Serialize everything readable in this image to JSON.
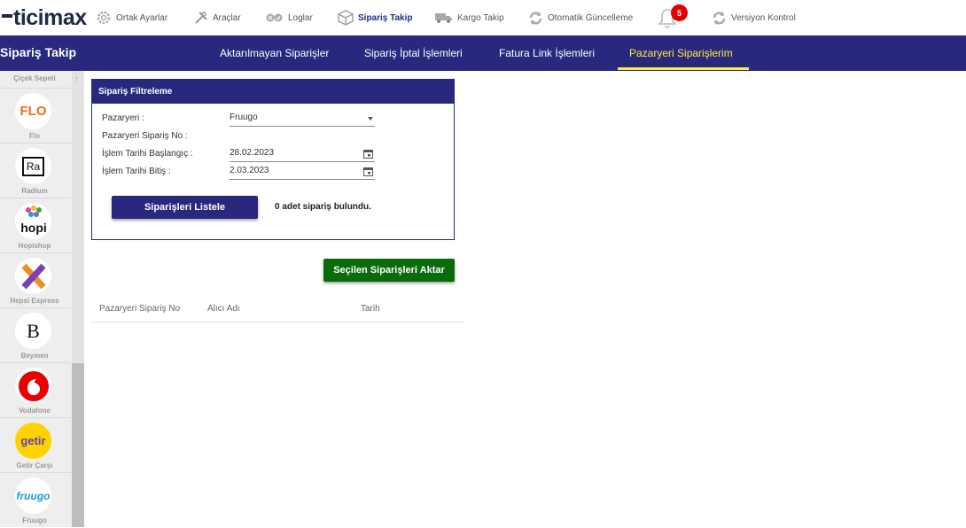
{
  "brand": {
    "logo_text": "ticimax"
  },
  "topnav": [
    {
      "label": "Ortak Ayarlar",
      "icon": "gear-icon"
    },
    {
      "label": "Araçlar",
      "icon": "tools-icon"
    },
    {
      "label": "Loglar",
      "icon": "logs-icon"
    },
    {
      "label": "Sipariş Takip",
      "icon": "box-icon",
      "active": true
    },
    {
      "label": "Kargo Takip",
      "icon": "truck-icon"
    },
    {
      "label": "Otomatik Güncelleme",
      "icon": "sync-icon"
    },
    {
      "label": "Versiyon Kontrol",
      "icon": "sync-icon"
    }
  ],
  "notifications": {
    "count": "5"
  },
  "header": {
    "page_title": "Sipariş Takip",
    "tabs": [
      {
        "label": "Aktarılmayan Siparişler"
      },
      {
        "label": "Sipariş İptal İşlemleri"
      },
      {
        "label": "Fatura Link İşlemleri"
      },
      {
        "label": "Pazaryeri Siparişlerim",
        "active": true
      }
    ]
  },
  "sidebar": {
    "first_label": "Çiçek Sepeti",
    "items": [
      {
        "label": "Flo",
        "logo": "FLO"
      },
      {
        "label": "Radium",
        "logo": "Ra"
      },
      {
        "label": "Hopishop",
        "logo": "hopi"
      },
      {
        "label": "Hepsi Express",
        "logo": "X"
      },
      {
        "label": "Beymen",
        "logo": "B"
      },
      {
        "label": "Vodafone",
        "logo": ""
      },
      {
        "label": "Getir Çarşı",
        "logo": "getir"
      },
      {
        "label": "Fruugo",
        "logo": "fruugo"
      }
    ]
  },
  "filter": {
    "title": "Sipariş Filtreleme",
    "marketplace_label": "Pazaryeri :",
    "marketplace_value": "Fruugo",
    "order_no_label": "Pazaryeri Sipariş No :",
    "order_no_value": "",
    "start_label": "İşlem Tarihi Başlangıç :",
    "start_value": "28.02.2023",
    "end_label": "İşlem Tarihi Bitiş :",
    "end_value": "2.03.2023",
    "list_button": "Siparişleri Listele",
    "result_text": "0 adet sipariş bulundu."
  },
  "actions": {
    "transfer_button": "Seçilen Siparişleri Aktar"
  },
  "table": {
    "headers": [
      "Pazaryeri Sipariş No",
      "Alıcı Adı",
      "Tarih"
    ],
    "rows": []
  },
  "colors": {
    "primary": "#28287e",
    "accent": "#ffeb3b",
    "success": "#0a6b0a",
    "badge": "#e10000"
  }
}
